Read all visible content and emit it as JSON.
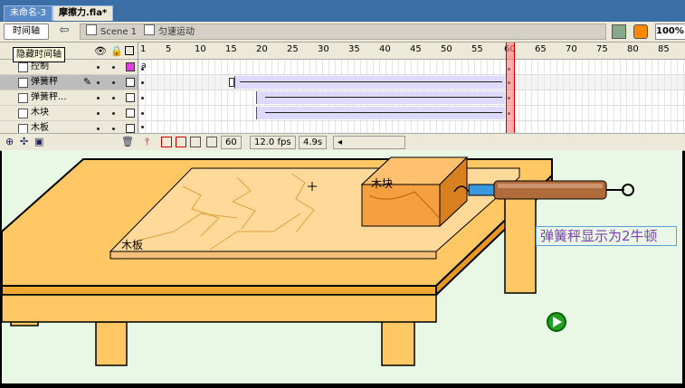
{
  "doc_tabs": [
    {
      "label": "未命名-3"
    },
    {
      "label": "摩擦力.fla*"
    }
  ],
  "timeline_bar": {
    "timeline_button": "时间轴",
    "scene_label": "Scene 1",
    "symbol_label": "匀速运动",
    "zoom": "100%"
  },
  "tooltip": "隐藏时间轴",
  "layers": [
    {
      "name": "控制"
    },
    {
      "name": "弹簧秤"
    },
    {
      "name": "弹簧秤..."
    },
    {
      "name": "木块"
    },
    {
      "name": "木板"
    }
  ],
  "frame_ruler": [
    "1",
    "5",
    "10",
    "15",
    "20",
    "25",
    "30",
    "35",
    "40",
    "45",
    "50",
    "55",
    "60",
    "65",
    "70",
    "75",
    "80",
    "85"
  ],
  "timeline_footer": {
    "current_frame": "60",
    "fps": "12.0 fps",
    "time": "4.9s"
  },
  "stage": {
    "block_label": "木块",
    "board_label": "木板",
    "readout_text": "弹簧秤显示为2牛顿"
  },
  "colors": {
    "table": "#ffc864",
    "board": "#ffd999",
    "block": "#f4a040",
    "stage_bg": "#e8f8e4",
    "readout_text": "#7a3fb0"
  }
}
